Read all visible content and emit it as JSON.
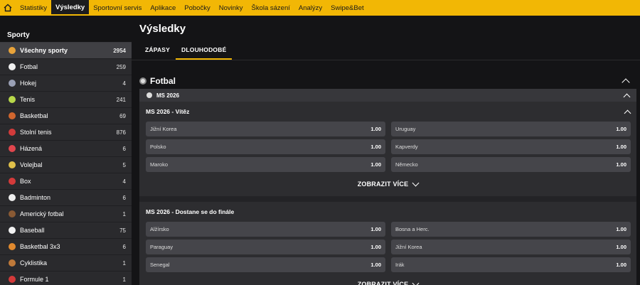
{
  "nav": {
    "items": [
      "Statistiky",
      "Výsledky",
      "Sportovní servis",
      "Aplikace",
      "Pobočky",
      "Novinky",
      "Škola sázení",
      "Analýzy",
      "Swipe&Bet"
    ],
    "active_index": 1
  },
  "sidebar": {
    "heading": "Sporty",
    "items": [
      {
        "label": "Všechny sporty",
        "count": "2954",
        "icon": "all-sports-icon",
        "color": "#e8a33a"
      },
      {
        "label": "Fotbal",
        "count": "259",
        "icon": "football-icon",
        "color": "#f0f0f0"
      },
      {
        "label": "Hokej",
        "count": "4",
        "icon": "hockey-icon",
        "color": "#9aa0b5"
      },
      {
        "label": "Tenis",
        "count": "241",
        "icon": "tennis-icon",
        "color": "#b8d84a"
      },
      {
        "label": "Basketbal",
        "count": "69",
        "icon": "basketball-icon",
        "color": "#d0662e"
      },
      {
        "label": "Stolní tenis",
        "count": "876",
        "icon": "table-tennis-icon",
        "color": "#d23b3b"
      },
      {
        "label": "Házená",
        "count": "6",
        "icon": "handball-icon",
        "color": "#e0464d"
      },
      {
        "label": "Volejbal",
        "count": "5",
        "icon": "volleyball-icon",
        "color": "#e0c04a"
      },
      {
        "label": "Box",
        "count": "4",
        "icon": "boxing-icon",
        "color": "#d43a3a"
      },
      {
        "label": "Badminton",
        "count": "6",
        "icon": "badminton-icon",
        "color": "#eeeeee"
      },
      {
        "label": "Americký fotbal",
        "count": "1",
        "icon": "american-football-icon",
        "color": "#8a5a34"
      },
      {
        "label": "Baseball",
        "count": "75",
        "icon": "baseball-icon",
        "color": "#f2f2f2"
      },
      {
        "label": "Basketbal 3x3",
        "count": "6",
        "icon": "basketball-3x3-icon",
        "color": "#e0892e"
      },
      {
        "label": "Cyklistika",
        "count": "1",
        "icon": "cycling-icon",
        "color": "#c07a3a"
      },
      {
        "label": "Formule 1",
        "count": "1",
        "icon": "formula-1-icon",
        "color": "#d43a3a"
      }
    ]
  },
  "main": {
    "title": "Výsledky",
    "tabs": [
      "ZÁPASY",
      "DLOUHODOBÉ"
    ],
    "active_tab": 1,
    "sport": "Fotbal",
    "competition": "MS 2026",
    "markets": [
      {
        "title": "MS 2026 - Vítěz",
        "odds": [
          {
            "label": "Jižní Korea",
            "value": "1.00"
          },
          {
            "label": "Uruguay",
            "value": "1.00"
          },
          {
            "label": "Polsko",
            "value": "1.00"
          },
          {
            "label": "Kapverdy",
            "value": "1.00"
          },
          {
            "label": "Maroko",
            "value": "1.00"
          },
          {
            "label": "Německo",
            "value": "1.00"
          }
        ],
        "more_label": "ZOBRAZIT VÍCE"
      },
      {
        "title": "MS 2026 - Dostane se do finále",
        "odds": [
          {
            "label": "Alžírsko",
            "value": "1.00"
          },
          {
            "label": "Bosna a Herc.",
            "value": "1.00"
          },
          {
            "label": "Paraguay",
            "value": "1.00"
          },
          {
            "label": "Jižní Korea",
            "value": "1.00"
          },
          {
            "label": "Senegal",
            "value": "1.00"
          },
          {
            "label": "Irák",
            "value": "1.00"
          }
        ],
        "more_label": "ZOBRAZIT VÍCE"
      }
    ]
  },
  "colors": {
    "accent": "#f2b705",
    "background": "#141416",
    "panel": "#2d2d30"
  }
}
